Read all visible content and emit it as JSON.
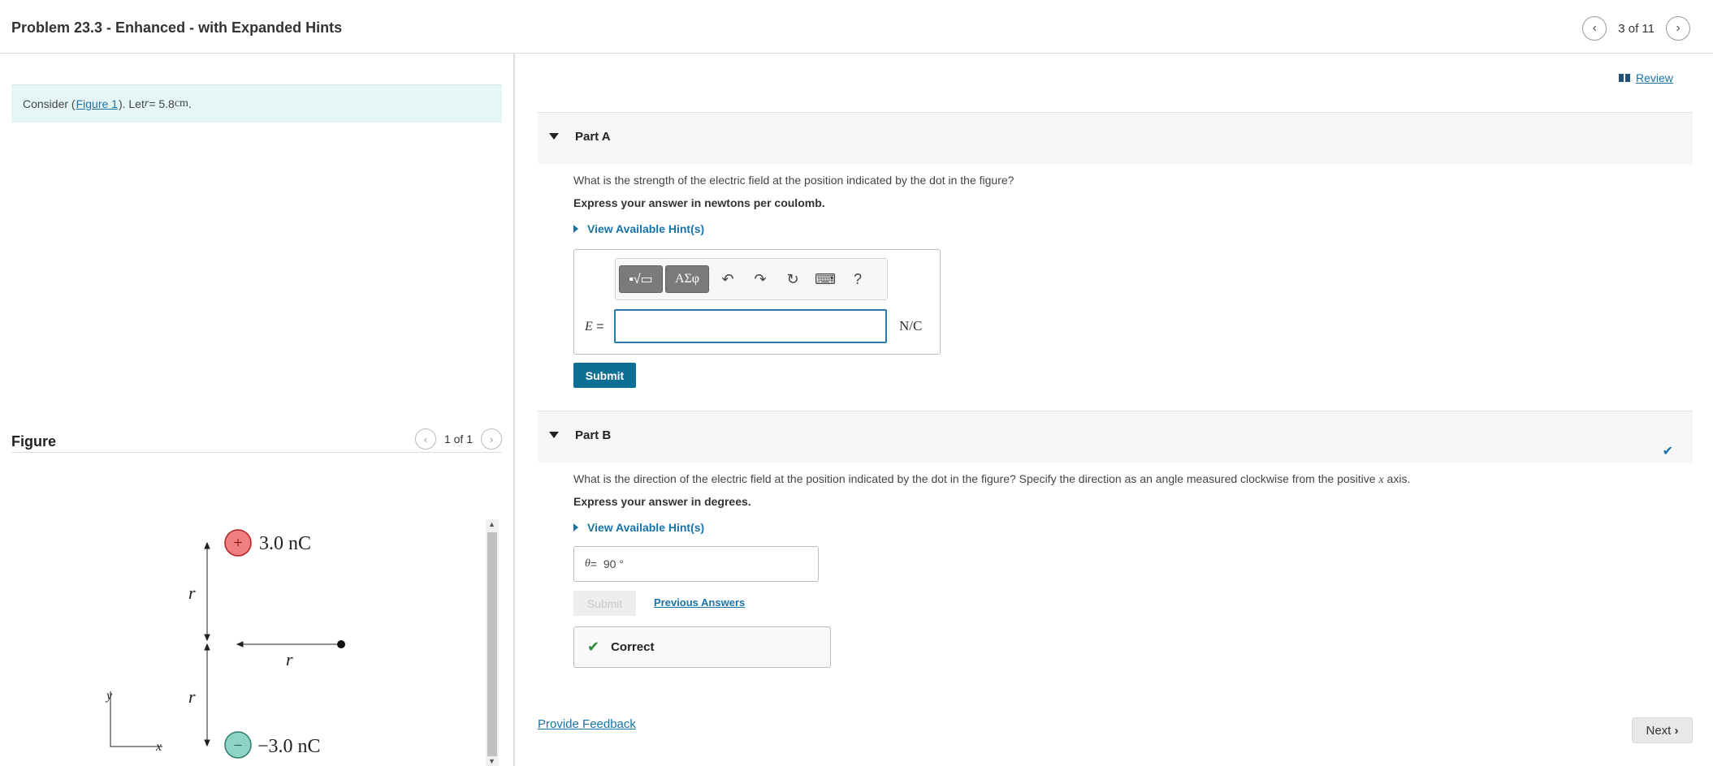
{
  "header": {
    "title": "Problem 23.3 - Enhanced - with Expanded Hints",
    "pager_text": "3 of 11",
    "prev_icon": "chevron-left-icon",
    "next_icon": "chevron-right-icon"
  },
  "left": {
    "consider_prefix": "Consider (",
    "figure_link": "Figure 1",
    "consider_mid": "). Let ",
    "var_r": "r",
    "consider_value": " = 5.8 ",
    "consider_unit": "cm",
    "consider_end": ".",
    "figure_title": "Figure",
    "figure_pager": "1 of 1",
    "figure": {
      "pos_charge": "3.0 nC",
      "neg_charge": "−3.0 nC",
      "r_label": "r",
      "axis_y": "y",
      "axis_x": "x",
      "plus_sign": "+",
      "minus_sign": "−"
    }
  },
  "right": {
    "review": "Review",
    "partA": {
      "label": "Part A",
      "question": "What is the strength of the electric field at the position indicated by the dot in the figure?",
      "instruction": "Express your answer in newtons per coulomb.",
      "hint": "View Available Hint(s)",
      "toolbar": {
        "template": "▪√▭",
        "greek": "ΑΣφ",
        "undo": "↶",
        "redo": "↷",
        "reset": "↻",
        "keyboard": "⌨",
        "help": "?"
      },
      "var_label": "E",
      "equals": " =",
      "input_value": "",
      "unit": "N/C",
      "submit": "Submit"
    },
    "partB": {
      "label": "Part B",
      "question_pre": "What is the direction of the electric field at the position indicated by the dot in the figure? Specify the direction as an angle measured clockwise from the positive ",
      "question_var": "x",
      "question_post": " axis.",
      "instruction": "Express your answer in degrees.",
      "hint": "View Available Hint(s)",
      "theta_label": "θ",
      "equals": " =",
      "answer": "90 °",
      "submit": "Submit",
      "previous_answers": "Previous Answers",
      "correct": "Correct",
      "status_check": "✔"
    },
    "feedback": "Provide Feedback",
    "next": "Next"
  },
  "colors": {
    "accent": "#0d6f94",
    "link": "#1a73a8",
    "pos_charge_fill": "#f08080",
    "neg_charge_fill": "#8fd3c4",
    "correct_green": "#2e8b3a",
    "consider_bg": "#e6f5f5"
  }
}
